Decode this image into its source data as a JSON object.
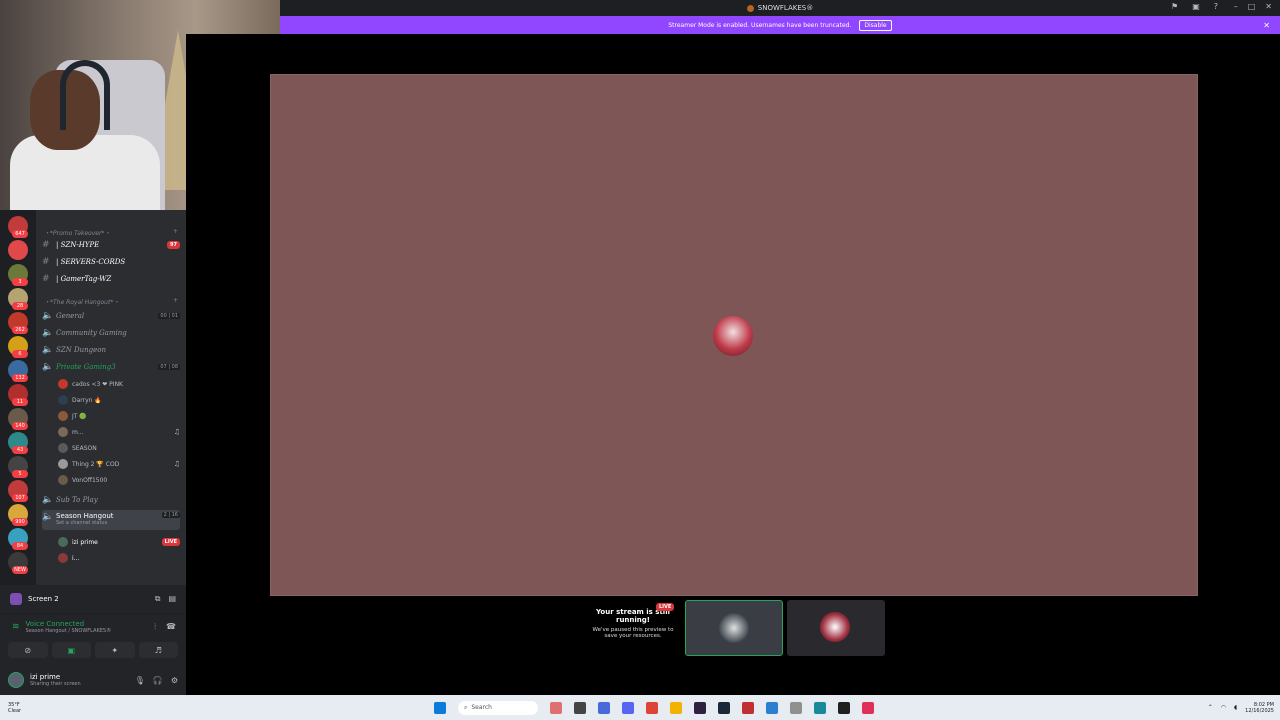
{
  "titlebar": {
    "title": "SNOWFLAKES®",
    "icons": [
      "pin-icon",
      "inbox-icon",
      "help-icon"
    ],
    "window_controls": [
      "–",
      "□",
      "✕"
    ]
  },
  "banner": {
    "text": "Streamer Mode is enabled. Usernames have been truncated.",
    "disable_label": "Disable",
    "close": "✕"
  },
  "servers": [
    {
      "badge": "647",
      "color": "#c23b3b"
    },
    {
      "badge": "",
      "color": "#e0484a"
    },
    {
      "badge": "3",
      "color": "#6b7a3a"
    },
    {
      "badge": "28",
      "color": "#b5a370"
    },
    {
      "badge": "262",
      "color": "#c0392b"
    },
    {
      "badge": "6",
      "color": "#d4a017"
    },
    {
      "badge": "132",
      "color": "#3a6aa0"
    },
    {
      "badge": "11",
      "color": "#b02e2e"
    },
    {
      "badge": "140",
      "color": "#6a5a4a"
    },
    {
      "badge": "43",
      "color": "#2e8a8a"
    },
    {
      "badge": "5",
      "color": "#444"
    },
    {
      "badge": "107",
      "color": "#c23b3b"
    },
    {
      "badge": "990",
      "color": "#d9a73a"
    },
    {
      "badge": "84",
      "color": "#3aa0c0"
    },
    {
      "badge": "NEW",
      "color": "#3a3a3a"
    }
  ],
  "channels": {
    "cat1": "・*Promo Takeover*・",
    "szn_hype": "| SZN-HYPE",
    "szn_hype_badge": "97",
    "servers_cords": "| SERVERS-CORDS",
    "gamertag": "| GamerTag-WZ",
    "cat2": "・*The Royal Hangout*・",
    "general": "General",
    "general_counts": "00 | 01",
    "community": "Community Gaming",
    "szn_dungeon": "SZN Dungeon",
    "private": "Private Gaming3",
    "private_counts": "07 | 08",
    "sub_to_play": "Sub To Play",
    "season_hangout": "Season Hangout",
    "season_status": "Set a channel status",
    "season_counts": "2 | 16"
  },
  "voice_users": [
    {
      "name": "cados <3 ❤ PINK",
      "color": "#c0392b",
      "ps": ""
    },
    {
      "name": "Darryn 🔥",
      "color": "#2c3e50",
      "ps": ""
    },
    {
      "name": "JT 🟢",
      "color": "#8a5a3a",
      "ps": ""
    },
    {
      "name": "m...",
      "color": "#7a6a5a",
      "ps": "♫"
    },
    {
      "name": "SEASON",
      "color": "#5a5a5a",
      "ps": ""
    },
    {
      "name": "Thing 2 🏆 COD",
      "color": "#9a9a9a",
      "ps": "♫"
    },
    {
      "name": "VonOff1500",
      "color": "#6a5a4a",
      "ps": ""
    }
  ],
  "hangout_users": [
    {
      "name": "izi prime",
      "live": "LIVE",
      "color": "#4a6a5a"
    },
    {
      "name": "i...",
      "live": "",
      "color": "#8a3a3a"
    }
  ],
  "screen_bar": {
    "label": "Screen 2"
  },
  "voice": {
    "title": "Voice Connected",
    "subtitle": "Season Hangout / SNOWFLAKES®"
  },
  "user": {
    "name": "izi prime",
    "status": "Sharing their screen"
  },
  "stream": {
    "paused_title": "Your stream is still running!",
    "paused_sub": "We've paused this preview to save your resources.",
    "live": "LIVE"
  },
  "taskbar": {
    "temp": "35°F",
    "weather": "Clear",
    "search_placeholder": "Search",
    "time": "8:02 PM",
    "date": "12/16/2025"
  }
}
